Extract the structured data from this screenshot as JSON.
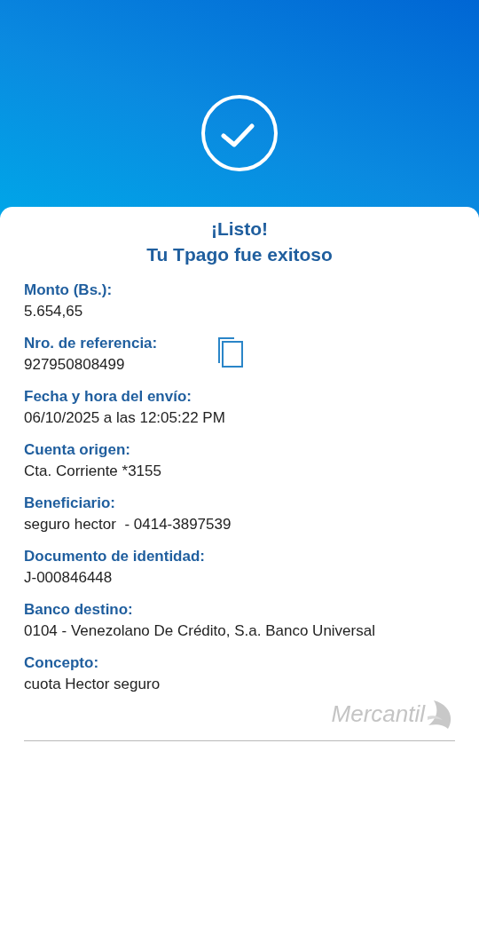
{
  "title": {
    "line_1": "¡Listo!",
    "line_2": "Tu Tpago fue exitoso"
  },
  "fields": [
    {
      "label": "Monto (Bs.):",
      "value": "5.654,65"
    },
    {
      "label": "Nro. de referencia:",
      "value": "927950808499",
      "copyable": true
    },
    {
      "label": "Fecha y hora del envío:",
      "value": "06/10/2025 a las 12:05:22 PM"
    },
    {
      "label": "Cuenta origen:",
      "value": "Cta. Corriente *3155"
    },
    {
      "label": "Beneficiario:",
      "value": "seguro hector  - 0414-3897539"
    },
    {
      "label": "Documento de identidad:",
      "value": "J-000846448"
    },
    {
      "label": "Banco destino:",
      "value": "0104 - Venezolano De Crédito, S.a. Banco Universal"
    },
    {
      "label": "Concepto:",
      "value": "cuota Hector seguro"
    }
  ],
  "brand": {
    "name": "Mercantil"
  }
}
